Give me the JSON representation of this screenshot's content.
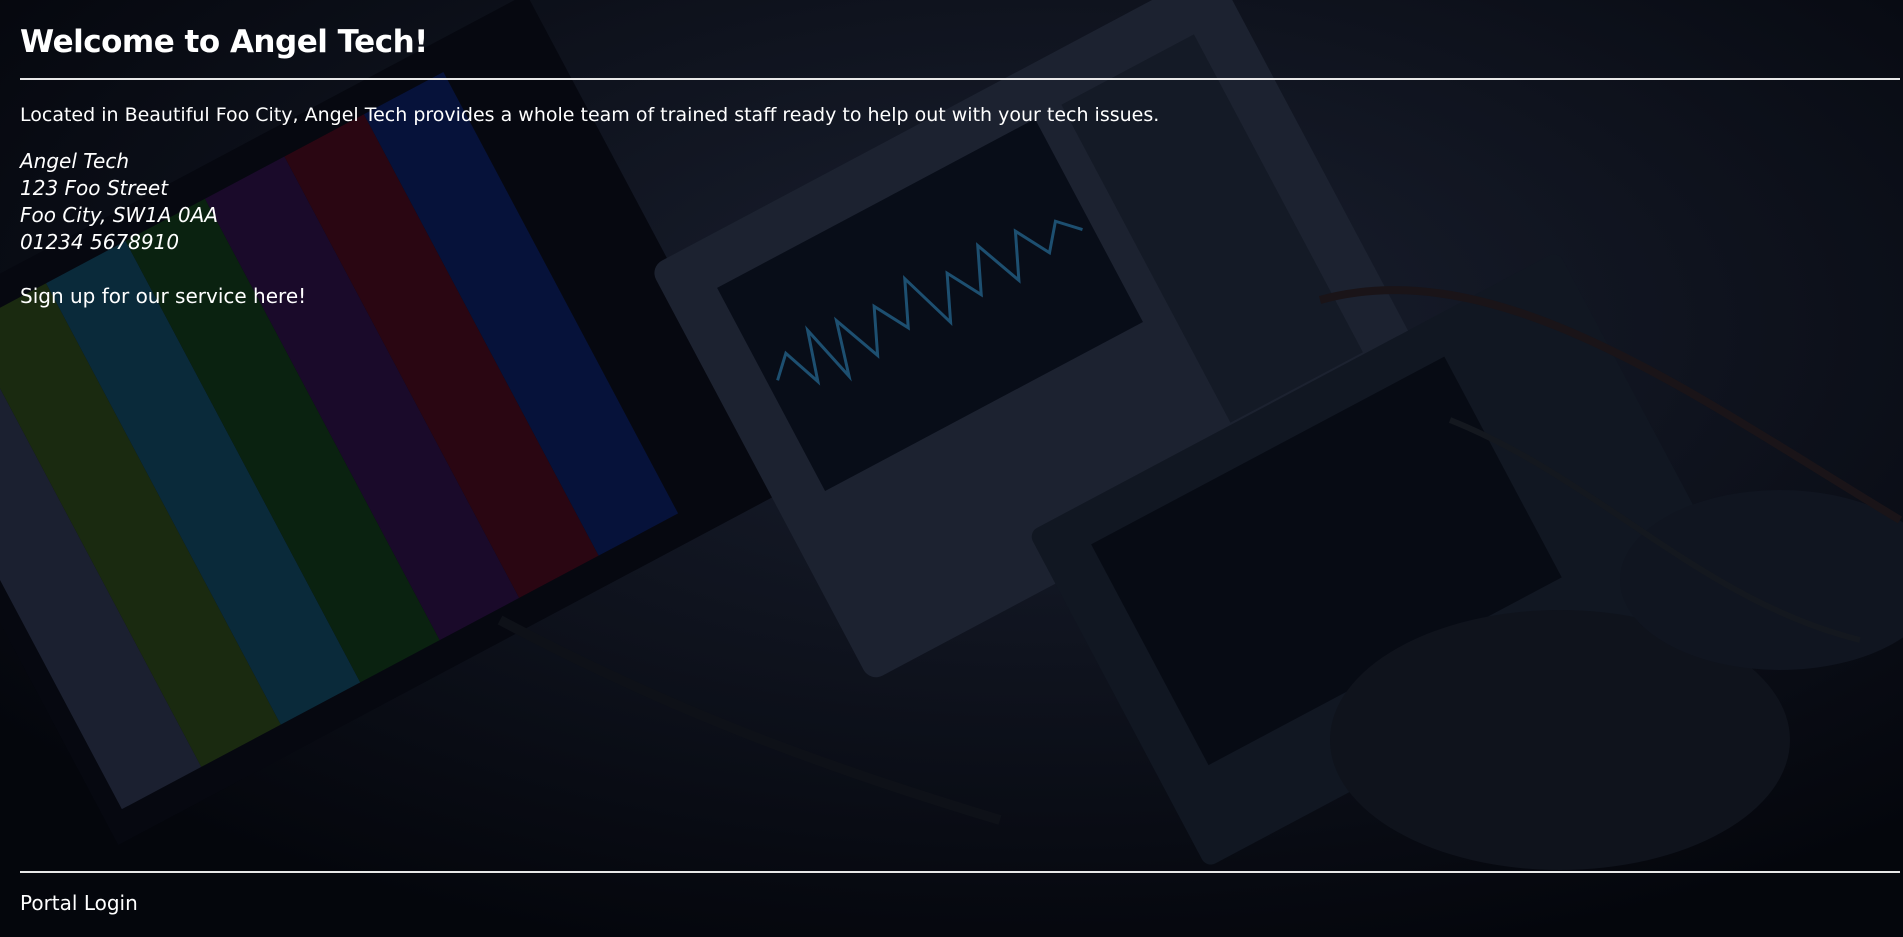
{
  "page": {
    "title": "Welcome to Angel Tech!",
    "intro": "Located in Beautiful Foo City, Angel Tech provides a whole team of trained staff ready to help out with your tech issues.",
    "address": {
      "name": "Angel Tech",
      "street": "123 Foo Street",
      "city": "Foo City, SW1A 0AA",
      "phone": "01234 5678910"
    },
    "signup_link": "Sign up for our service here!",
    "footer_link": "Portal Login"
  },
  "colors": {
    "background": "#05070f",
    "text": "#ffffff",
    "rule": "#e8e8e8"
  }
}
